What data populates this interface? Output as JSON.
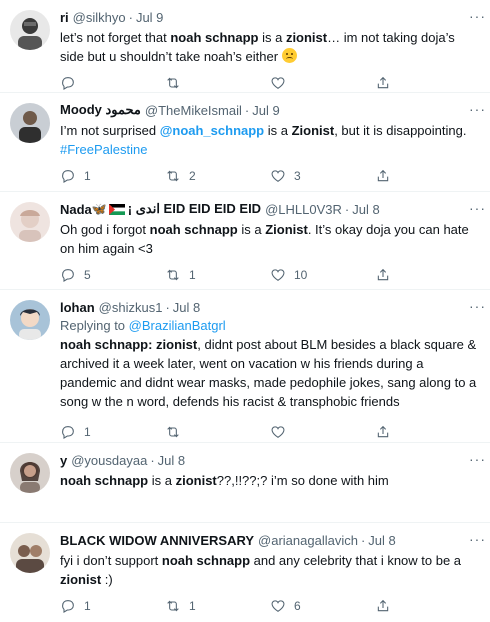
{
  "more_glyph": "···",
  "dot": "·",
  "tweets": [
    {
      "name": "ri",
      "handle": "@silkhyo",
      "time": "Jul 9",
      "text_parts": [
        "let’s not forget that ",
        "noah schnapp",
        " is a ",
        "zionist",
        "… im not taking doja’s side but u shouldn’t take noah’s either "
      ],
      "counts": {
        "reply": "",
        "retweet": "",
        "like": ""
      },
      "avatar_color": "#3a3a3a"
    },
    {
      "name": "Moody محمود",
      "handle": "@TheMikeIsmail",
      "time": "Jul 9",
      "text_parts": [
        "I’m not surprised ",
        "@noah_schnapp",
        " is a ",
        "Zionist",
        ", but it is disappointing. ",
        "#FreePalestine"
      ],
      "counts": {
        "reply": "1",
        "retweet": "2",
        "like": "3"
      },
      "avatar_color": "#8a8f96"
    },
    {
      "name": "Nada",
      "name_suffix": "¡ اندى EID EID EID EID",
      "handle": "@LHLL0V3R",
      "time": "Jul 8",
      "text_parts": [
        "Oh god i forgot ",
        "noah schnapp",
        " is a ",
        "Zionist",
        ". It’s okay doja you can hate on him again <3"
      ],
      "counts": {
        "reply": "5",
        "retweet": "1",
        "like": "10"
      },
      "avatar_color": "#d9c9c4"
    },
    {
      "name": "lohan",
      "handle": "@shizkus1",
      "time": "Jul 8",
      "replying_label": "Replying to ",
      "replying_to": "@BrazilianBatgrl",
      "text_parts": [
        "noah schnapp: zionist",
        ", didnt post about BLM besides a black square & archived it a week later, went on vacation w his friends during a pandemic and didnt wear masks, made pedophile jokes, sang along to a song w the n word, defends his racist & transphobic friends"
      ],
      "counts": {
        "reply": "1",
        "retweet": "",
        "like": ""
      },
      "avatar_color": "#2b2f3a"
    },
    {
      "name": "y",
      "handle": "@yousdayaa",
      "time": "Jul 8",
      "text_parts": [
        "noah schnapp",
        " is a ",
        "zionist",
        "??,!!??;? i’m so done with him"
      ],
      "counts": {
        "reply": "",
        "retweet": "",
        "like": ""
      },
      "avatar_color": "#4a3b36"
    },
    {
      "name": "BLACK WIDOW ANNIVERSARY",
      "handle": "@arianagallavich",
      "time": "Jul 8",
      "text_parts": [
        "fyi i don’t support ",
        "noah schnapp",
        " and any celebrity that i know to be a ",
        "zionist",
        " :)"
      ],
      "counts": {
        "reply": "1",
        "retweet": "1",
        "like": "6"
      },
      "avatar_color": "#6b5a4e"
    }
  ]
}
